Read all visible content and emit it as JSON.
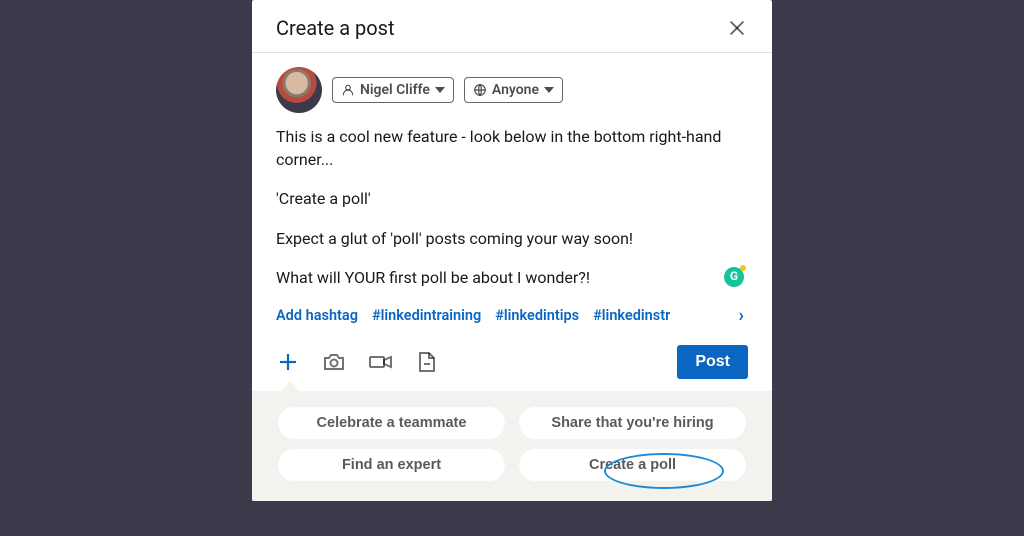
{
  "modal": {
    "title": "Create a post"
  },
  "author": {
    "name": "Nigel Cliffe",
    "visibility": "Anyone"
  },
  "post": {
    "p1": "This is a cool new feature - look below in the bottom right-hand corner...",
    "p2": "'Create a poll'",
    "p3": "Expect a glut of 'poll' posts coming your way soon!",
    "p4": "What will YOUR first poll be about I wonder?!"
  },
  "hashtags": {
    "add": "Add hashtag",
    "tags": [
      "#linkedintraining",
      "#linkedintips",
      "#linkedinstr"
    ]
  },
  "actions": {
    "post": "Post"
  },
  "chips": {
    "c1": "Celebrate a teammate",
    "c2": "Share that you're hiring",
    "c3": "Find an expert",
    "c4": "Create a poll"
  },
  "grammarly": "G"
}
